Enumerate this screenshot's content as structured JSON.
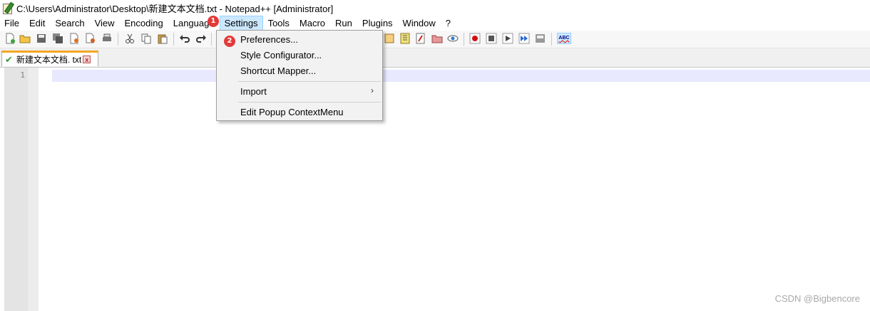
{
  "window": {
    "title": "C:\\Users\\Administrator\\Desktop\\新建文本文档.txt - Notepad++ [Administrator]"
  },
  "menubar": {
    "items": [
      {
        "label": "File"
      },
      {
        "label": "Edit"
      },
      {
        "label": "Search"
      },
      {
        "label": "View"
      },
      {
        "label": "Encoding"
      },
      {
        "label": "Language"
      },
      {
        "label": "Settings"
      },
      {
        "label": "Tools"
      },
      {
        "label": "Macro"
      },
      {
        "label": "Run"
      },
      {
        "label": "Plugins"
      },
      {
        "label": "Window"
      },
      {
        "label": "?"
      }
    ],
    "active": "Settings"
  },
  "toolbar": {
    "spellcheck_label": "ABC"
  },
  "tabs": [
    {
      "label": "新建文本文档. txt",
      "close": "x"
    }
  ],
  "editor": {
    "line_number": "1"
  },
  "settings_menu": {
    "items": [
      {
        "label": "Preferences..."
      },
      {
        "label": "Style Configurator..."
      },
      {
        "label": "Shortcut Mapper..."
      },
      {
        "label": "Import",
        "submenu_arrow": "›"
      },
      {
        "label": "Edit Popup ContextMenu"
      }
    ]
  },
  "annotations": {
    "step1": "1",
    "step2": "2"
  },
  "watermark": "CSDN @Bigbencore",
  "colors": {
    "menu_highlight": "#cce8ff",
    "current_line": "#e8e8ff",
    "badge": "#e23a3a",
    "tab_accent": "#f5a623"
  }
}
